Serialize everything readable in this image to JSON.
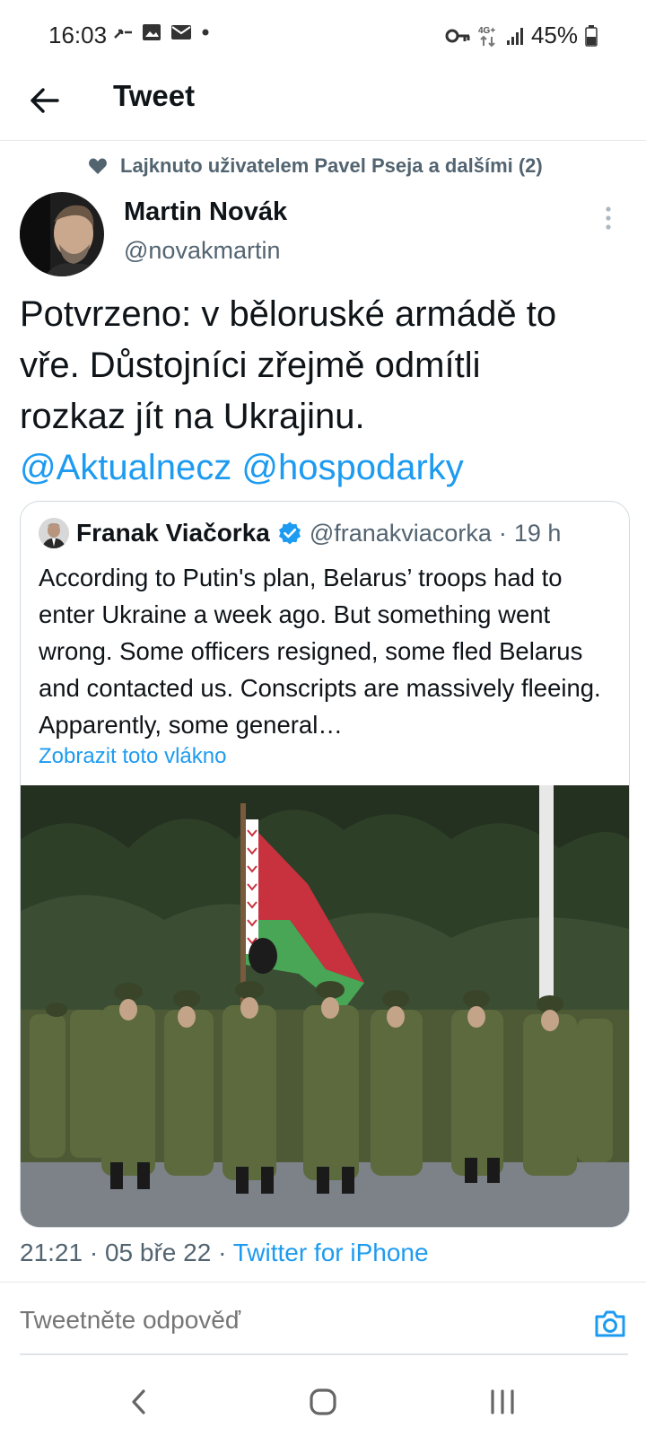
{
  "status_bar": {
    "time": "16:03",
    "battery": "45%",
    "network": "4G+",
    "left_icons": [
      "call-forward-icon",
      "image-icon",
      "mail-icon",
      "dot-icon"
    ],
    "right_icons": [
      "vpn-key-icon",
      "network-4g-icon",
      "signal-icon",
      "battery-icon"
    ]
  },
  "header": {
    "title": "Tweet"
  },
  "social_context": {
    "text": "Lajknuto uživatelem Pavel Pseja a dalšími (2)"
  },
  "tweet": {
    "author_name": "Martin Novák",
    "author_handle": "@novakmartin",
    "text_line1": "Potvrzeno: v běloruské armádě to",
    "text_line2": "vře. Důstojníci zřejmě odmítli",
    "text_line3": "rozkaz jít na Ukrajinu.",
    "mention1": "@Aktualnecz",
    "mention2": "@hospodarky",
    "time": "21:21",
    "sep1": "·",
    "date": "05 bře 22",
    "sep2": "·",
    "source": "Twitter for iPhone"
  },
  "quote": {
    "author_name": "Franak Viačorka",
    "author_handle": "@franakviacorka",
    "sep": "·",
    "age": "19 h",
    "text": "According to Putin's plan, Belarus’ troops had to enter Ukraine a week ago. But something went wrong. Some officers resigned, some fled Belarus and contacted us. Conscripts are massively fleeing. Apparently, some general…",
    "show_thread": "Zobrazit toto vlákno"
  },
  "reply": {
    "placeholder": "Tweetněte odpověď"
  },
  "colors": {
    "accent": "#1d9bf0",
    "secondary_text": "#536471",
    "primary_text": "#0f1419",
    "flag_red": "#c8313e",
    "flag_green": "#4aa657"
  }
}
